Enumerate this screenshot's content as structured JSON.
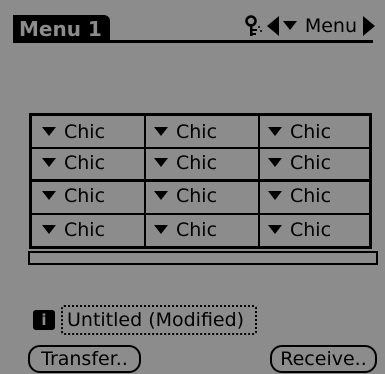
{
  "header": {
    "title": "Menu 1",
    "menu_label": "Menu"
  },
  "grid": {
    "rows": [
      [
        "Chic",
        "Chic",
        "Chic"
      ],
      [
        "Chic",
        "Chic",
        "Chic"
      ],
      [
        "Chic",
        "Chic",
        "Chic"
      ],
      [
        "Chic",
        "Chic",
        "Chic"
      ]
    ]
  },
  "footer": {
    "info_label": "i",
    "file_name": "Untitled (Modified)",
    "transfer_label": "Transfer..",
    "receive_label": "Receive.."
  },
  "colors": {
    "background": "#8c8c8c",
    "foreground": "#000000"
  },
  "icons": [
    "key-icon",
    "arrow-left-icon",
    "dropdown-triangle-icon",
    "arrow-right-icon"
  ]
}
